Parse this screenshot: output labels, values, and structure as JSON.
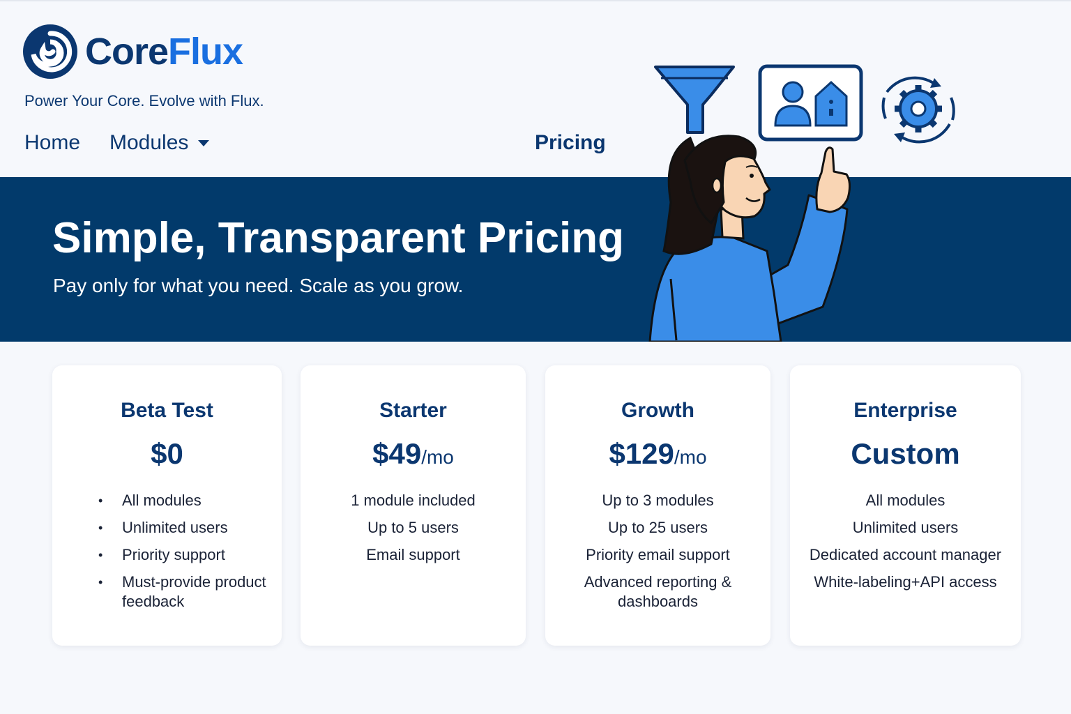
{
  "brand": {
    "name_part1": "Core",
    "name_part2": "Flux",
    "tagline": "Power Your Core. Evolve with Flux."
  },
  "nav": {
    "home": "Home",
    "modules": "Modules",
    "pricing": "Pricing"
  },
  "hero": {
    "title": "Simple, Transparent Pricing",
    "subtitle": "Pay only for what you need. Scale as you grow."
  },
  "plans": [
    {
      "name": "Beta Test",
      "price": "$0",
      "per": "",
      "features": [
        "All modules",
        "Unlimited users",
        "Priority support",
        "Must-provide product feedback"
      ]
    },
    {
      "name": "Starter",
      "price": "$49",
      "per": "/mo",
      "features": [
        "1 module included",
        "Up to 5 users",
        "Email support"
      ]
    },
    {
      "name": "Growth",
      "price": "$129",
      "per": "/mo",
      "features": [
        "Up to 3 modules",
        "Up to 25 users",
        "Priority email support",
        "Advanced reporting & dashboards"
      ]
    },
    {
      "name": "Enterprise",
      "price": "Custom",
      "per": "",
      "features": [
        "All modules",
        "Unlimited users",
        "Dedicated account manager",
        "White-labeling+API access"
      ]
    }
  ],
  "colors": {
    "navy": "#023a6b",
    "brand_blue": "#1a6fe0",
    "icon_blue": "#3a8de8"
  },
  "icons": [
    "logo-swirl-icon",
    "funnel-icon",
    "profile-card-icon",
    "gear-sync-icon"
  ]
}
